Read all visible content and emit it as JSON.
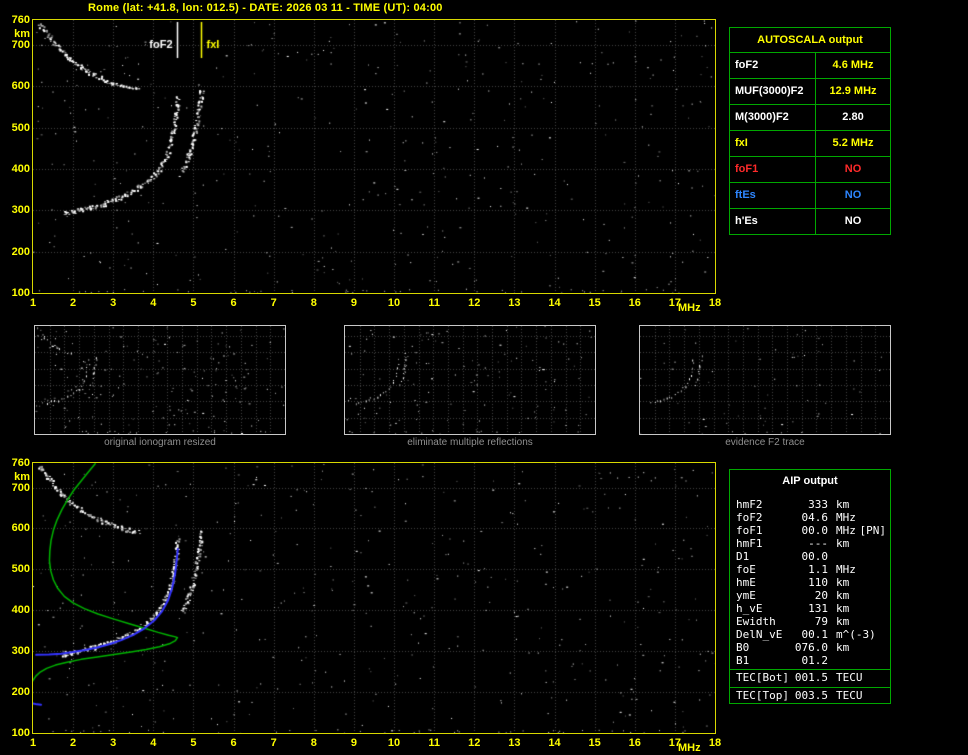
{
  "header": {
    "title": "Rome (lat: +41.8, lon: 012.5) - DATE: 2026 03 11 - TIME (UT): 04:00"
  },
  "colors": {
    "axis": "#ffff00",
    "grid": "#454545",
    "panel_border": "#d8d800",
    "table_border": "#00a800",
    "profile_green": "#00b400",
    "trace_blue": "#3333ff",
    "caption_gray": "#8f8f8f"
  },
  "captions": {
    "thumb1": "original ionogram resized",
    "thumb2": "eliminate multiple reflections",
    "thumb3": "evidence F2 trace"
  },
  "autoscala": {
    "title": "AUTOSCALA output",
    "rows": [
      {
        "label": "foF2",
        "value": "4.6 MHz",
        "label_color": "#ffffff",
        "value_color": "#ffff00"
      },
      {
        "label": "MUF(3000)F2",
        "value": "12.9 MHz",
        "label_color": "#ffffff",
        "value_color": "#ffff00"
      },
      {
        "label": "M(3000)F2",
        "value": "2.80",
        "label_color": "#ffffff",
        "value_color": "#ffffff"
      },
      {
        "label": "fxI",
        "value": "5.2 MHz",
        "label_color": "#ffff00",
        "value_color": "#ffff00"
      },
      {
        "label": "foF1",
        "value": "NO",
        "label_color": "#ff2a2a",
        "value_color": "#ff2a2a"
      },
      {
        "label": "ftEs",
        "value": "NO",
        "label_color": "#2e86ff",
        "value_color": "#2e86ff"
      },
      {
        "label": "h'Es",
        "value": "NO",
        "label_color": "#ffffff",
        "value_color": "#ffffff"
      }
    ]
  },
  "aip": {
    "title": "AIP output",
    "rows": [
      {
        "name": "hmF2",
        "value": "333",
        "unit": "km"
      },
      {
        "name": "foF2",
        "value": "04.6",
        "unit": "MHz"
      },
      {
        "name": "foF1",
        "value": "00.0",
        "unit": "MHz",
        "extra": "[PN]"
      },
      {
        "name": "hmF1",
        "value": "---",
        "unit": "km"
      },
      {
        "name": "D1",
        "value": "00.0",
        "unit": ""
      },
      {
        "name": "foE",
        "value": "1.1",
        "unit": "MHz"
      },
      {
        "name": "hmE",
        "value": "110",
        "unit": "km"
      },
      {
        "name": "ymE",
        "value": "20",
        "unit": "km"
      },
      {
        "name": "h_vE",
        "value": "131",
        "unit": "km"
      },
      {
        "name": "Ewidth",
        "value": "79",
        "unit": "km"
      },
      {
        "name": "DelN_vE",
        "value": "00.1",
        "unit": "m^(-3)"
      },
      {
        "name": "B0",
        "value": "076.0",
        "unit": "km"
      },
      {
        "name": "B1",
        "value": "01.2",
        "unit": ""
      }
    ],
    "tec_rows": [
      {
        "name": "TEC[Bot]",
        "value": "001.5",
        "unit": "TECU"
      },
      {
        "name": "TEC[Top]",
        "value": "003.5",
        "unit": "TECU"
      }
    ]
  },
  "chart_data": {
    "type": "scatter",
    "title": "Ionogram - Rome 2026-03-11 04:00 UT",
    "x_label": "MHz",
    "y_label": "km",
    "x_range": [
      1,
      18
    ],
    "y_range": [
      100,
      760
    ],
    "x_ticks": [
      1,
      2,
      3,
      4,
      5,
      6,
      7,
      8,
      9,
      10,
      11,
      12,
      13,
      14,
      15,
      16,
      17,
      18
    ],
    "y_ticks": [
      760,
      700,
      600,
      500,
      400,
      300,
      200,
      100
    ],
    "grid": "dotted",
    "markers": [
      {
        "label": "foF2",
        "freq_mhz": 4.6,
        "color": "#ffffff",
        "side": "left"
      },
      {
        "label": "fxI",
        "freq_mhz": 5.2,
        "color": "#ffff00",
        "side": "right"
      }
    ],
    "traces": {
      "f2_ordinary": [
        [
          1.75,
          293
        ],
        [
          1.95,
          297
        ],
        [
          2.15,
          301
        ],
        [
          2.35,
          306
        ],
        [
          2.55,
          311
        ],
        [
          2.75,
          317
        ],
        [
          2.95,
          324
        ],
        [
          3.15,
          332
        ],
        [
          3.35,
          341
        ],
        [
          3.55,
          352
        ],
        [
          3.75,
          365
        ],
        [
          3.95,
          380
        ],
        [
          4.1,
          396
        ],
        [
          4.22,
          414
        ],
        [
          4.32,
          434
        ],
        [
          4.4,
          456
        ],
        [
          4.46,
          480
        ],
        [
          4.51,
          506
        ],
        [
          4.55,
          532
        ],
        [
          4.58,
          556
        ],
        [
          4.6,
          578
        ]
      ],
      "f2_extraordinary": [
        [
          4.72,
          398
        ],
        [
          4.82,
          420
        ],
        [
          4.9,
          444
        ],
        [
          4.98,
          470
        ],
        [
          5.04,
          498
        ],
        [
          5.09,
          526
        ],
        [
          5.13,
          552
        ],
        [
          5.17,
          576
        ],
        [
          5.19,
          596
        ]
      ],
      "second_hop_echo": [
        [
          1.15,
          752
        ],
        [
          1.3,
          733
        ],
        [
          1.45,
          714
        ],
        [
          1.6,
          696
        ],
        [
          1.78,
          678
        ],
        [
          1.98,
          661
        ],
        [
          2.2,
          645
        ],
        [
          2.45,
          631
        ],
        [
          2.7,
          619
        ],
        [
          2.95,
          609
        ],
        [
          3.2,
          601
        ],
        [
          3.45,
          596
        ],
        [
          3.65,
          592
        ]
      ],
      "electron_density_profile": [
        [
          2.55,
          758
        ],
        [
          2.38,
          738
        ],
        [
          2.2,
          716
        ],
        [
          2.02,
          694
        ],
        [
          1.86,
          670
        ],
        [
          1.72,
          646
        ],
        [
          1.6,
          621
        ],
        [
          1.51,
          596
        ],
        [
          1.45,
          571
        ],
        [
          1.42,
          546
        ],
        [
          1.41,
          521
        ],
        [
          1.44,
          497
        ],
        [
          1.51,
          474
        ],
        [
          1.62,
          453
        ],
        [
          1.78,
          434
        ],
        [
          2.0,
          418
        ],
        [
          2.28,
          404
        ],
        [
          2.62,
          391
        ],
        [
          3.0,
          379
        ],
        [
          3.4,
          367
        ],
        [
          3.78,
          356
        ],
        [
          4.12,
          346
        ],
        [
          4.38,
          339
        ],
        [
          4.55,
          335
        ],
        [
          4.6,
          333
        ],
        [
          4.55,
          326
        ],
        [
          4.4,
          318
        ],
        [
          4.15,
          311
        ],
        [
          3.82,
          304
        ],
        [
          3.44,
          298
        ],
        [
          3.02,
          292
        ],
        [
          2.6,
          286
        ],
        [
          2.2,
          280
        ],
        [
          1.85,
          273
        ],
        [
          1.56,
          266
        ],
        [
          1.34,
          258
        ],
        [
          1.18,
          249
        ],
        [
          1.07,
          239
        ],
        [
          1.0,
          229
        ],
        [
          0.95,
          218
        ],
        [
          0.92,
          206
        ],
        [
          0.9,
          194
        ]
      ],
      "restored_trace": [
        [
          1.08,
          291
        ],
        [
          1.4,
          292
        ],
        [
          1.7,
          294
        ],
        [
          2.0,
          298
        ],
        [
          2.3,
          303
        ],
        [
          2.6,
          309
        ],
        [
          2.9,
          317
        ],
        [
          3.2,
          327
        ],
        [
          3.5,
          340
        ],
        [
          3.78,
          356
        ],
        [
          4.02,
          375
        ],
        [
          4.22,
          398
        ],
        [
          4.37,
          425
        ],
        [
          4.47,
          455
        ],
        [
          4.54,
          488
        ],
        [
          4.58,
          520
        ],
        [
          4.61,
          550
        ]
      ],
      "e_region_mark": [
        [
          1.0,
          172
        ],
        [
          1.1,
          170
        ],
        [
          1.2,
          169
        ]
      ]
    },
    "panels": [
      {
        "name": "main-ionogram",
        "traces": [
          "second_hop_echo",
          "f2_ordinary",
          "f2_extraordinary"
        ],
        "noise_seed": 11,
        "noise_count": 420,
        "markers": true
      },
      {
        "name": "thumb-original",
        "traces": [
          "second_hop_echo",
          "f2_ordinary",
          "f2_extraordinary"
        ],
        "noise_seed": 21,
        "noise_count": 170
      },
      {
        "name": "thumb-filtered",
        "traces": [
          "f2_ordinary",
          "f2_extraordinary"
        ],
        "noise_seed": 31,
        "noise_count": 120
      },
      {
        "name": "thumb-f2",
        "traces": [
          "f2_ordinary",
          "f2_extraordinary"
        ],
        "noise_seed": 41,
        "noise_count": 55
      },
      {
        "name": "restored-ionogram",
        "traces": [
          "second_hop_echo",
          "f2_ordinary",
          "f2_extraordinary"
        ],
        "noise_seed": 51,
        "noise_count": 420,
        "lines": [
          {
            "trace": "electron_density_profile",
            "color_key": "profile_green",
            "width": 1.5
          },
          {
            "trace": "restored_trace",
            "color_key": "trace_blue",
            "width": 2
          },
          {
            "trace": "e_region_mark",
            "color_key": "trace_blue",
            "width": 2
          }
        ]
      }
    ]
  }
}
